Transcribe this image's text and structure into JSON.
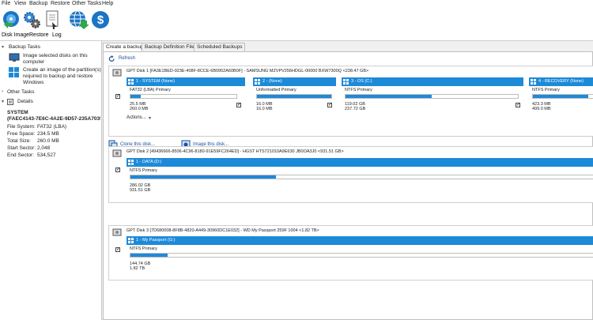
{
  "menu": [
    "File",
    "View",
    "Backup",
    "Restore",
    "Other Tasks",
    "Help"
  ],
  "main_tabs": [
    "Disk Image",
    "Restore",
    "Log"
  ],
  "left": {
    "backup_tasks_header": "Backup Tasks",
    "task1": "Image selected disks on this computer",
    "task2": "Create an image of the partition(s) required to backup and restore Windows",
    "other_tasks_header": "Other Tasks",
    "details_header": "Details",
    "detail_name": "SYSTEM",
    "detail_guid": "(FAEC4143-7E6C-4A2E-9D57-235A7035",
    "fs_label": "File System:",
    "fs_value": "FAT32 (LBA)",
    "free_label": "Free Space:",
    "free_value": "234.5 MB",
    "total_label": "Total Size:",
    "total_value": "260.0 MB",
    "start_label": "Start Sector:",
    "start_value": "2,048",
    "end_label": "End Sector:",
    "end_value": "534,527"
  },
  "right_tabs": [
    "Create a backup",
    "Backup Definition Files",
    "Scheduled Backups"
  ],
  "refresh": "Refresh",
  "disk1": {
    "header": "GPT Disk 1 [FA3E1BED-923E-408F-8CCE-6B0952A60B0F] - SAMSUNG MZVPV256HDGL-00000 BXW7300Q  <238.47 GB>",
    "actions": "Actions...",
    "partitions": [
      {
        "title": "1 - SYSTEM (None)",
        "type": "FAT32 (LBA) Primary",
        "used": "25.5 MB",
        "total": "260.0 MB",
        "fill": 0.1
      },
      {
        "title": "2 -  (None)",
        "type": "Unformatted Primary",
        "used": "16.0 MB",
        "total": "16.0 MB",
        "fill": 1.0
      },
      {
        "title": "3 - OS (C:)",
        "type": "NTFS Primary",
        "used": "119.02 GB",
        "total": "237.72 GB",
        "fill": 0.5
      },
      {
        "title": "4 - RECOVERY (None)",
        "type": "NTFS Primary",
        "used": "423.3 MB",
        "total": "499.0 MB",
        "fill": 0.85
      }
    ]
  },
  "clone_link": "Clone this disk...",
  "image_link": "Image this disk...",
  "disk2": {
    "header": "GPT Disk 2 [49436666-8506-4C96-8180-91E59FC264ED] - HGST HTS721010A9E630 JB0OA3J0  <931.51 GB>",
    "partition": {
      "title": "1 - DATA (D:)",
      "type": "NTFS Primary",
      "used": "286.02 GB",
      "total": "931.51 GB",
      "fill": 0.31
    }
  },
  "disk3": {
    "header": "GPT Disk 3 [7D680008-8F8B-4820-A449-30960DC1E032] - WD       My Passport 259F 1004  <1.82 TB>",
    "partition": {
      "title": "1 - My Passport (G:)",
      "type": "NTFS Primary",
      "used": "144.74 GB",
      "total": "1.82 TB",
      "fill": 0.08
    }
  },
  "check_mark": "✓"
}
